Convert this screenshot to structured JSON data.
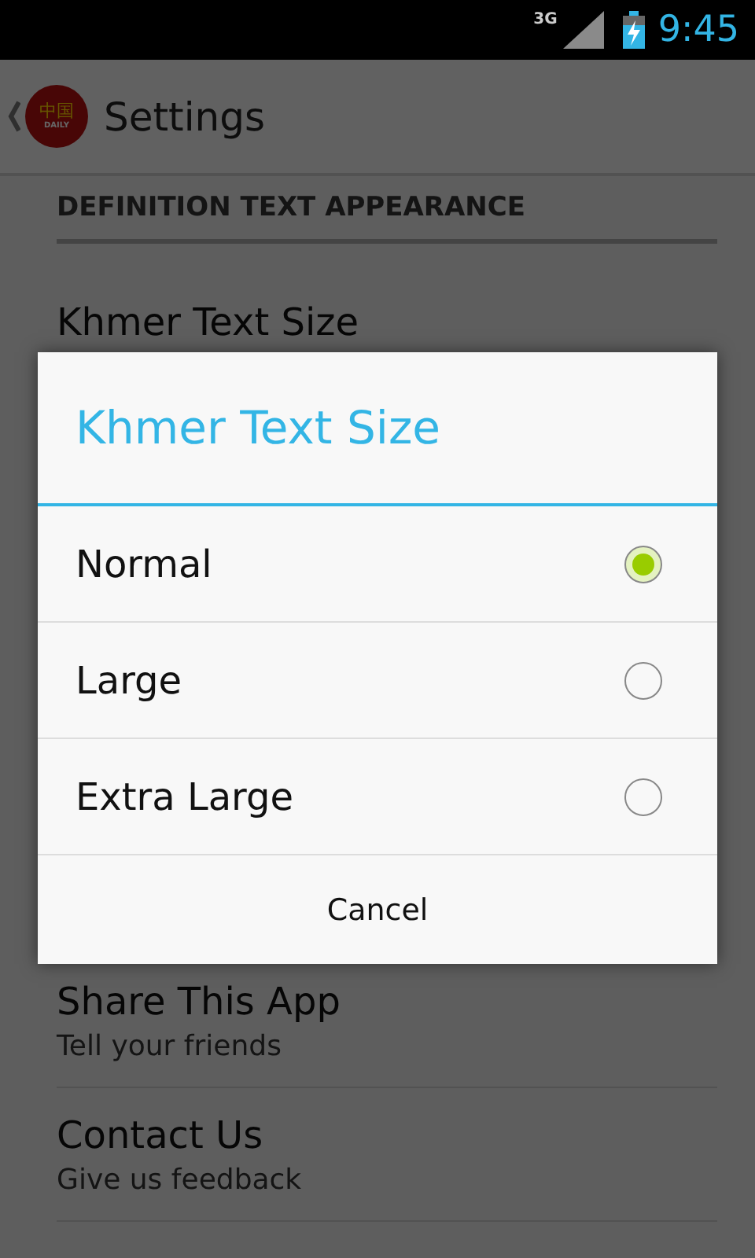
{
  "status_bar": {
    "network": "3G",
    "time": "9:45"
  },
  "action_bar": {
    "logo_top": "中国",
    "logo_bottom": "DAILY",
    "title": "Settings"
  },
  "section_header": "DEFINITION TEXT APPEARANCE",
  "settings": [
    {
      "title": "Khmer Text Size"
    },
    {
      "title": "Share This App",
      "summary": "Tell your friends"
    },
    {
      "title": "Contact Us",
      "summary": "Give us feedback"
    }
  ],
  "dialog": {
    "title": "Khmer Text Size",
    "options": [
      {
        "label": "Normal",
        "selected": true
      },
      {
        "label": "Large",
        "selected": false
      },
      {
        "label": "Extra Large",
        "selected": false
      }
    ],
    "cancel": "Cancel"
  }
}
